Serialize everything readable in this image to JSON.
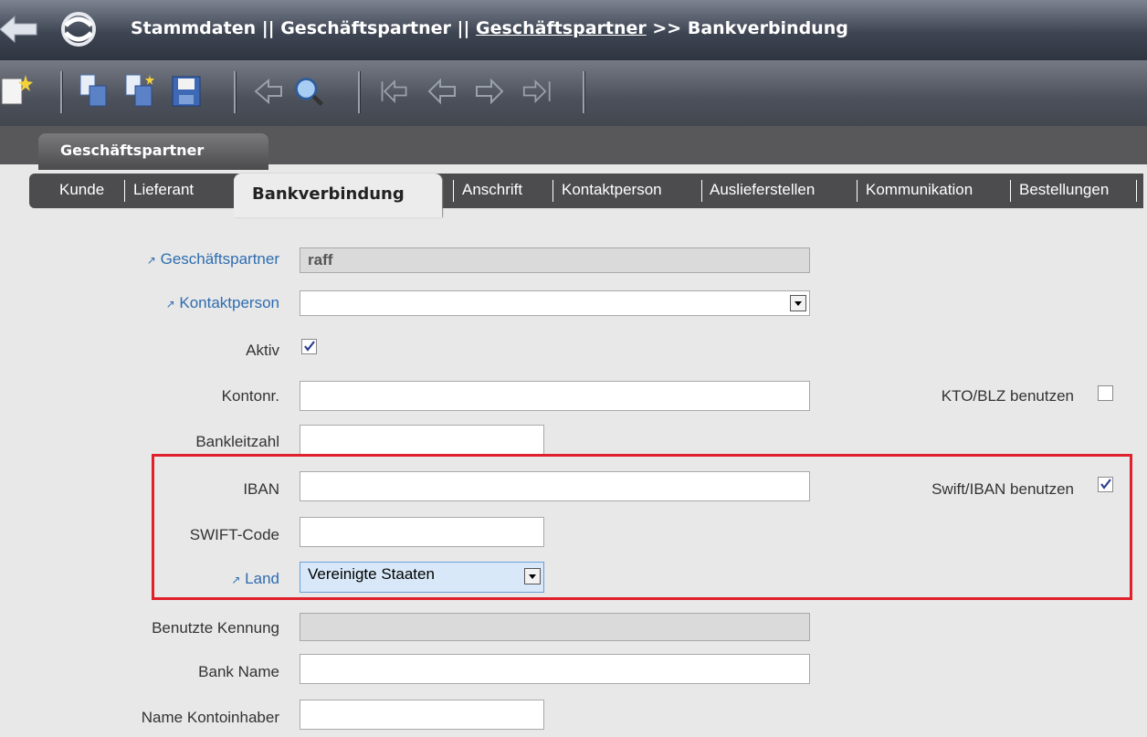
{
  "header": {
    "breadcrumb_part1": "Stammdaten || Geschäftspartner || ",
    "breadcrumb_link": "Geschäftspartner",
    "breadcrumb_part2": " >> Bankverbindung"
  },
  "outer_tab": {
    "label": "Geschäftspartner"
  },
  "tabs": [
    {
      "label": "Kunde"
    },
    {
      "label": "Lieferant"
    },
    {
      "label": "Bankverbindung",
      "active": true
    },
    {
      "label": "Anschrift"
    },
    {
      "label": "Kontaktperson"
    },
    {
      "label": "Auslieferstellen"
    },
    {
      "label": "Kommunikation"
    },
    {
      "label": "Bestellungen"
    }
  ],
  "form": {
    "geschaeftspartner": {
      "label": "Geschäftspartner",
      "value": "raff"
    },
    "kontaktperson": {
      "label": "Kontaktperson",
      "value": ""
    },
    "aktiv": {
      "label": "Aktiv",
      "checked": true
    },
    "kontonr": {
      "label": "Kontonr.",
      "value": ""
    },
    "kto_blz": {
      "label": "KTO/BLZ benutzen",
      "checked": false
    },
    "bankleitzahl": {
      "label": "Bankleitzahl",
      "value": ""
    },
    "iban": {
      "label": "IBAN",
      "value": ""
    },
    "swift_iban": {
      "label": "Swift/IBAN benutzen",
      "checked": true
    },
    "swift_code": {
      "label": "SWIFT-Code",
      "value": ""
    },
    "land": {
      "label": "Land",
      "value": "Vereinigte Staaten"
    },
    "benutzte_kennung": {
      "label": "Benutzte Kennung",
      "value": ""
    },
    "bank_name": {
      "label": "Bank Name",
      "value": ""
    },
    "name_kontoinhaber": {
      "label": "Name Kontoinhaber",
      "value": ""
    }
  },
  "colors": {
    "highlight_border": "#e0202a",
    "link_blue": "#2e6db0"
  }
}
